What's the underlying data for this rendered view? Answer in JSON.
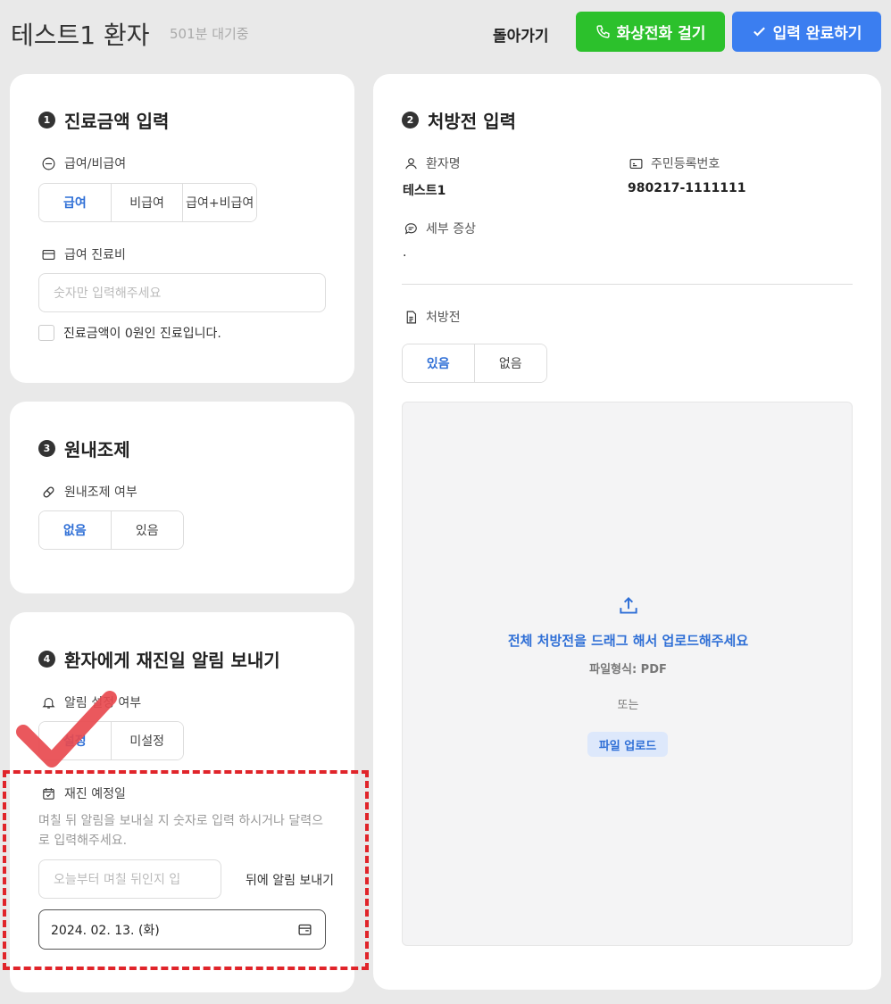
{
  "header": {
    "patient_name": "테스트1 환자",
    "wait_status": "501분 대기중",
    "back_label": "돌아가기",
    "video_call_label": "화상전화 걸기",
    "complete_label": "입력 완료하기"
  },
  "billing": {
    "number": "1",
    "title": "진료금액 입력",
    "type_label": "급여/비급여",
    "type_options": [
      "급여",
      "비급여",
      "급여+비급여"
    ],
    "type_selected": "급여",
    "fee_label": "급여 진료비",
    "fee_placeholder": "숫자만 입력해주세요",
    "zero_checkbox_label": "진료금액이 0원인 진료입니다."
  },
  "prescription": {
    "number": "2",
    "title": "처방전 입력",
    "patient_name_label": "환자명",
    "patient_name_value": "테스트1",
    "rrn_label": "주민등록번호",
    "rrn_value": "980217-1111111",
    "symptom_label": "세부 증상",
    "symptom_value": ".",
    "prescription_label": "처방전",
    "prescription_options": [
      "있음",
      "없음"
    ],
    "prescription_selected": "있음",
    "dropzone_main": "전체 처방전을 드래그 해서 업로드해주세요",
    "dropzone_format": "파일형식: PDF",
    "dropzone_or": "또는",
    "upload_button": "파일 업로드"
  },
  "dispensing": {
    "number": "3",
    "title": "원내조제",
    "label": "원내조제 여부",
    "options": [
      "없음",
      "있음"
    ],
    "selected": "없음"
  },
  "revisit": {
    "number": "4",
    "title": "환자에게 재진일 알림 보내기",
    "alarm_label": "알림 설정 여부",
    "alarm_options": [
      "설정",
      "미설정"
    ],
    "alarm_selected": "설정",
    "date_label": "재진 예정일",
    "helper_text": "며칠 뒤 알림을 보내실 지 숫자로 입력 하시거나 달력으로 입력해주세요.",
    "days_placeholder": "오늘부터 며칠 뒤인지 입",
    "after_label": "뒤에 알림 보내기",
    "date_value": "2024. 02. 13. (화)"
  },
  "colors": {
    "accent_blue": "#2f6fd6",
    "video_green": "#2cc12c",
    "complete_blue": "#3b7ef0",
    "annotation_red": "#e0242a"
  },
  "icons": [
    "phone-icon",
    "check-icon",
    "won-coin-icon",
    "card-icon",
    "pill-icon",
    "bell-icon",
    "calendar-check-icon",
    "user-icon",
    "id-card-icon",
    "chat-icon",
    "document-icon",
    "upload-icon",
    "calendar-icon"
  ]
}
